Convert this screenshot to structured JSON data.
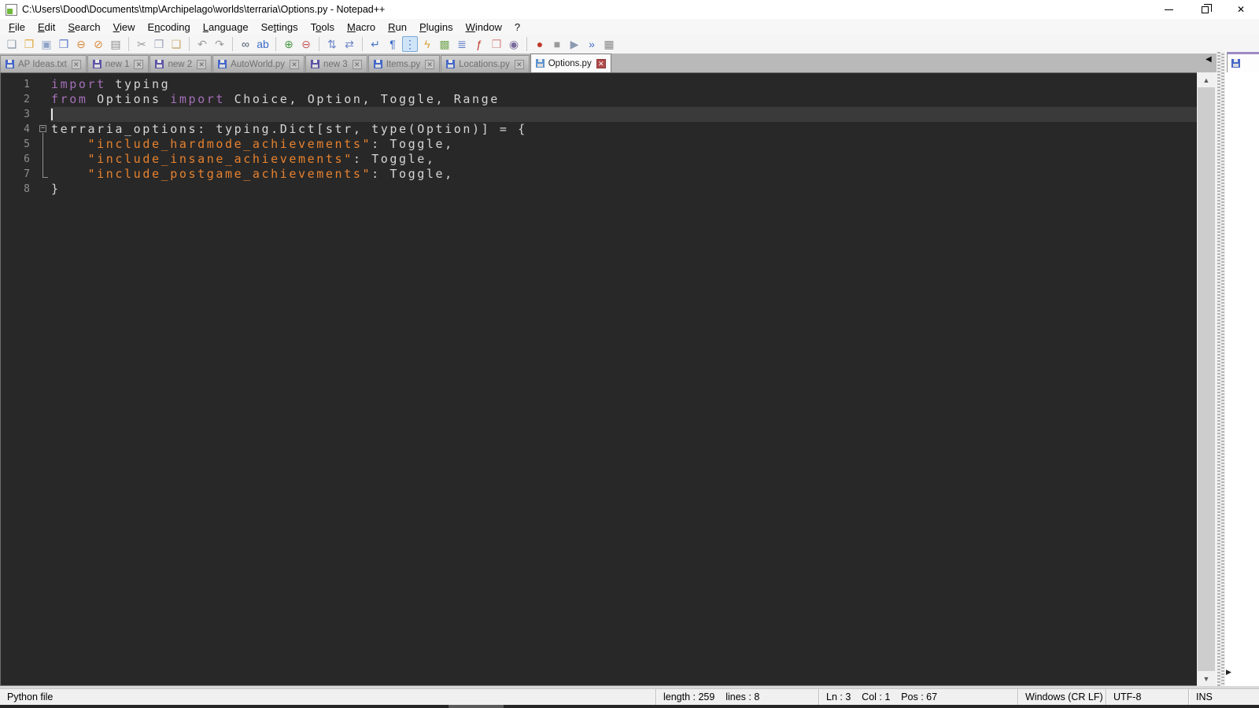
{
  "window": {
    "title": "C:\\Users\\Dood\\Documents\\tmp\\Archipelago\\worlds\\terraria\\Options.py - Notepad++"
  },
  "menu": {
    "items": [
      {
        "label": "File",
        "m": 0
      },
      {
        "label": "Edit",
        "m": 0
      },
      {
        "label": "Search",
        "m": 0
      },
      {
        "label": "View",
        "m": 0
      },
      {
        "label": "Encoding",
        "m": 1
      },
      {
        "label": "Language",
        "m": 0
      },
      {
        "label": "Settings",
        "m": 2
      },
      {
        "label": "Tools",
        "m": 1
      },
      {
        "label": "Macro",
        "m": 0
      },
      {
        "label": "Run",
        "m": 0
      },
      {
        "label": "Plugins",
        "m": 0
      },
      {
        "label": "Window",
        "m": 0
      },
      {
        "label": "?",
        "m": -1
      }
    ]
  },
  "toolbar": {
    "groups": [
      [
        {
          "name": "new-file-icon",
          "glyph": "❏",
          "color": "#8a9aa8"
        },
        {
          "name": "open-file-icon",
          "glyph": "❐",
          "color": "#e0a93c"
        },
        {
          "name": "save-icon",
          "glyph": "▣",
          "color": "#8fa3c8"
        },
        {
          "name": "save-all-icon",
          "glyph": "❒",
          "color": "#5b79c9"
        },
        {
          "name": "close-file-icon",
          "glyph": "⊖",
          "color": "#d98a3c"
        },
        {
          "name": "close-all-icon",
          "glyph": "⊘",
          "color": "#d98a3c"
        },
        {
          "name": "print-icon",
          "glyph": "▤",
          "color": "#8a8a8a"
        }
      ],
      [
        {
          "name": "cut-icon",
          "glyph": "✂",
          "color": "#9a9a9a"
        },
        {
          "name": "copy-icon",
          "glyph": "❐",
          "color": "#9aa6b8"
        },
        {
          "name": "paste-icon",
          "glyph": "❑",
          "color": "#c8a86a"
        }
      ],
      [
        {
          "name": "undo-icon",
          "glyph": "↶",
          "color": "#9a9a9a"
        },
        {
          "name": "redo-icon",
          "glyph": "↷",
          "color": "#9a9a9a"
        }
      ],
      [
        {
          "name": "find-icon",
          "glyph": "∞",
          "color": "#4a5a6a"
        },
        {
          "name": "replace-icon",
          "glyph": "ab",
          "color": "#3c6bc9"
        }
      ],
      [
        {
          "name": "zoom-in-icon",
          "glyph": "⊕",
          "color": "#4a9a4a"
        },
        {
          "name": "zoom-out-icon",
          "glyph": "⊖",
          "color": "#c95b5b"
        }
      ],
      [
        {
          "name": "sync-vertical-scroll-icon",
          "glyph": "⇅",
          "color": "#6a84c9"
        },
        {
          "name": "sync-horizontal-scroll-icon",
          "glyph": "⇄",
          "color": "#6a84c9"
        }
      ],
      [
        {
          "name": "word-wrap-icon",
          "glyph": "↵",
          "color": "#4a7ac9"
        },
        {
          "name": "show-all-characters-icon",
          "glyph": "¶",
          "color": "#3c6bc9"
        },
        {
          "name": "show-indent-guide-icon",
          "glyph": "⋮",
          "color": "#3c6bc9",
          "active": true
        },
        {
          "name": "function-list-icon",
          "glyph": "ϟ",
          "color": "#d8a23c"
        },
        {
          "name": "document-map-icon",
          "glyph": "▩",
          "color": "#7aa95b"
        },
        {
          "name": "document-list-icon",
          "glyph": "≣",
          "color": "#5b79c9"
        },
        {
          "name": "view-file-icon",
          "glyph": "ƒ",
          "color": "#c0392b"
        },
        {
          "name": "folder-as-workspace-icon",
          "glyph": "❐",
          "color": "#d98a8a"
        },
        {
          "name": "monitoring-eye-icon",
          "glyph": "◉",
          "color": "#7a6a9a"
        }
      ],
      [
        {
          "name": "macro-record-icon",
          "glyph": "●",
          "color": "#c0392b"
        },
        {
          "name": "macro-stop-icon",
          "glyph": "■",
          "color": "#9a9a9a"
        },
        {
          "name": "macro-play-icon",
          "glyph": "▶",
          "color": "#8a9ab0"
        },
        {
          "name": "macro-run-multiple-icon",
          "glyph": "»",
          "color": "#3c6bc9"
        },
        {
          "name": "macro-save-icon",
          "glyph": "▦",
          "color": "#8a8a8a"
        }
      ]
    ]
  },
  "tabs": [
    {
      "label": "AP Ideas.txt",
      "state": "saved",
      "active": false
    },
    {
      "label": "new 1",
      "state": "modified",
      "active": false
    },
    {
      "label": "new 2",
      "state": "modified",
      "active": false
    },
    {
      "label": "AutoWorld.py",
      "state": "saved",
      "active": false
    },
    {
      "label": "new 3",
      "state": "modified",
      "active": false
    },
    {
      "label": "Items.py",
      "state": "saved",
      "active": false
    },
    {
      "label": "Locations.py",
      "state": "saved",
      "active": false
    },
    {
      "label": "Options.py",
      "state": "saved",
      "active": true
    }
  ],
  "editor": {
    "lines": [
      {
        "num": "1",
        "fold": "",
        "current": false,
        "cursor": false,
        "tokens": [
          {
            "c": "k",
            "t": "import"
          },
          {
            "c": "d",
            "t": " typing"
          }
        ]
      },
      {
        "num": "2",
        "fold": "",
        "current": false,
        "cursor": false,
        "tokens": [
          {
            "c": "k",
            "t": "from"
          },
          {
            "c": "d",
            "t": " Options "
          },
          {
            "c": "k",
            "t": "import"
          },
          {
            "c": "d",
            "t": " Choice, Option, Toggle, Range"
          }
        ]
      },
      {
        "num": "3",
        "fold": "",
        "current": true,
        "cursor": true,
        "tokens": []
      },
      {
        "num": "4",
        "fold": "box",
        "current": false,
        "cursor": false,
        "tokens": [
          {
            "c": "d",
            "t": "terraria_options: typing.Dict[str, type(Option)] = {"
          }
        ]
      },
      {
        "num": "5",
        "fold": "line",
        "current": false,
        "cursor": false,
        "tokens": [
          {
            "c": "d",
            "t": "    "
          },
          {
            "c": "s",
            "t": "\"include_hardmode_achievements\""
          },
          {
            "c": "d",
            "t": ": Toggle,"
          }
        ]
      },
      {
        "num": "6",
        "fold": "line",
        "current": false,
        "cursor": false,
        "tokens": [
          {
            "c": "d",
            "t": "    "
          },
          {
            "c": "s",
            "t": "\"include_insane_achievements\""
          },
          {
            "c": "d",
            "t": ": Toggle,"
          }
        ]
      },
      {
        "num": "7",
        "fold": "end",
        "current": false,
        "cursor": false,
        "tokens": [
          {
            "c": "d",
            "t": "    "
          },
          {
            "c": "s",
            "t": "\"include_postgame_achievements\""
          },
          {
            "c": "d",
            "t": ": Toggle,"
          }
        ]
      },
      {
        "num": "8",
        "fold": "",
        "current": false,
        "cursor": false,
        "tokens": [
          {
            "c": "d",
            "t": "}"
          }
        ]
      }
    ]
  },
  "status": {
    "doc_type": "Python file",
    "length_info": "length : 259    lines : 8",
    "caret_info": "Ln : 3    Col : 1    Pos : 67",
    "eol": "Windows (CR LF)",
    "encoding": "UTF-8",
    "typing_mode": "INS"
  },
  "colors": {
    "keyword": "#a46fb8",
    "string": "#e8822e",
    "default_text": "#d6d6d6",
    "editor_bg": "#282828",
    "current_line": "#3a3a3a",
    "active_close": "#b04a4a"
  }
}
